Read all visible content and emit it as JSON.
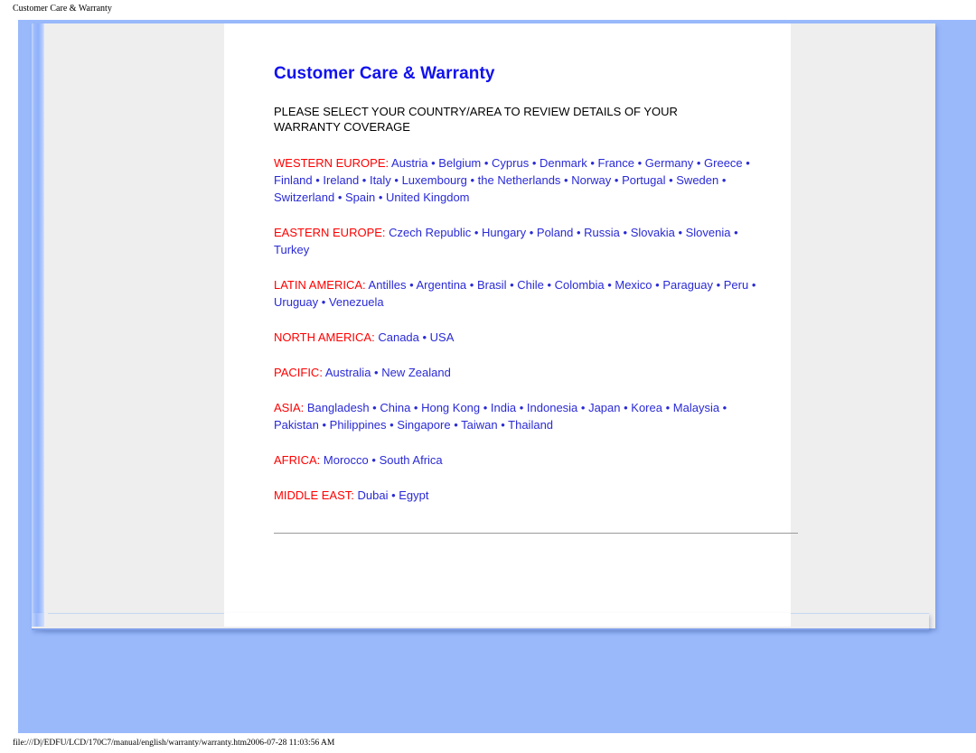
{
  "browser": {
    "header_title": "Customer Care & Warranty",
    "footer_path": "file:///D|/EDFU/LCD/170C7/manual/english/warranty/warranty.htm2006-07-28 11:03:56 AM"
  },
  "colors": {
    "page_background_blue": "#99b9fb",
    "panel_grey": "#eeeeee",
    "content_white": "#ffffff",
    "title_blue": "#1111ee",
    "region_red": "#ff0000",
    "link_blue": "#2a2ad6",
    "rule_grey": "#9a9a9a"
  },
  "main": {
    "title": "Customer Care & Warranty",
    "intro": "PLEASE SELECT YOUR COUNTRY/AREA TO REVIEW DETAILS OF YOUR WARRANTY COVERAGE",
    "separator": "•",
    "regions": [
      {
        "name": "WESTERN EUROPE:",
        "countries": [
          "Austria",
          "Belgium",
          "Cyprus",
          "Denmark",
          "France",
          "Germany",
          "Greece",
          "Finland",
          "Ireland",
          "Italy",
          "Luxembourg",
          "the Netherlands",
          "Norway",
          "Portugal",
          "Sweden",
          "Switzerland",
          "Spain",
          "United Kingdom"
        ]
      },
      {
        "name": "EASTERN EUROPE:",
        "countries": [
          "Czech Republic",
          "Hungary",
          "Poland",
          "Russia",
          "Slovakia",
          "Slovenia",
          "Turkey"
        ]
      },
      {
        "name": "LATIN AMERICA:",
        "countries": [
          "Antilles",
          "Argentina",
          "Brasil",
          "Chile",
          "Colombia",
          "Mexico",
          "Paraguay",
          "Peru",
          "Uruguay",
          "Venezuela"
        ]
      },
      {
        "name": "NORTH AMERICA:",
        "countries": [
          "Canada",
          "USA"
        ]
      },
      {
        "name": "PACIFIC:",
        "countries": [
          "Australia",
          "New Zealand"
        ]
      },
      {
        "name": "ASIA:",
        "countries": [
          "Bangladesh",
          "China",
          "Hong Kong",
          "India",
          "Indonesia",
          "Japan",
          "Korea",
          "Malaysia",
          "Pakistan",
          "Philippines",
          "Singapore",
          "Taiwan",
          "Thailand"
        ]
      },
      {
        "name": "AFRICA:",
        "countries": [
          "Morocco",
          "South Africa"
        ]
      },
      {
        "name": "MIDDLE EAST:",
        "countries": [
          "Dubai",
          "Egypt"
        ]
      }
    ]
  }
}
